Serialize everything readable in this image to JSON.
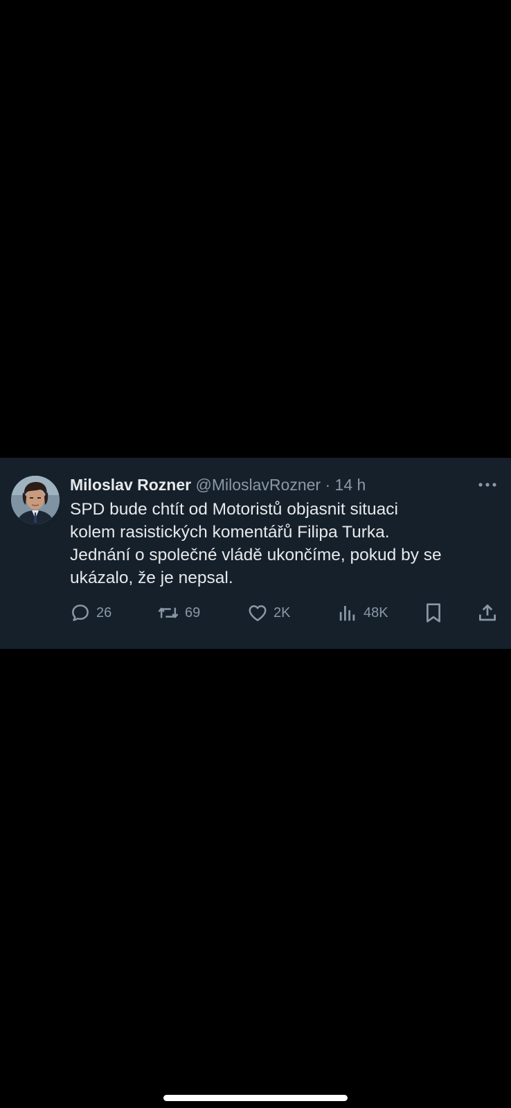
{
  "tweet": {
    "author_name": "Miloslav Rozner",
    "handle": "@MiloslavRozner",
    "separator": "·",
    "time": "14 h",
    "text": "SPD bude chtít od Motoristů objasnit situaci\nkolem rasistických komentářů Filipa Turka.\nJednání o společné vládě ukončíme, pokud by se\nukázalo, že je nepsal.",
    "avatar_icon": "person-photo-avatar",
    "more_icon": "more-horizontal-icon"
  },
  "actions": {
    "reply": {
      "icon": "reply-icon",
      "count": "26"
    },
    "repost": {
      "icon": "repost-icon",
      "count": "69"
    },
    "like": {
      "icon": "heart-icon",
      "count": "2K"
    },
    "views": {
      "icon": "views-chart-icon",
      "count": "48K"
    },
    "bookmark": {
      "icon": "bookmark-icon"
    },
    "share": {
      "icon": "share-icon"
    }
  },
  "colors": {
    "background": "#000000",
    "card": "#15202b",
    "primary_text": "#e7e9ea",
    "secondary_text": "#8b98a5"
  }
}
